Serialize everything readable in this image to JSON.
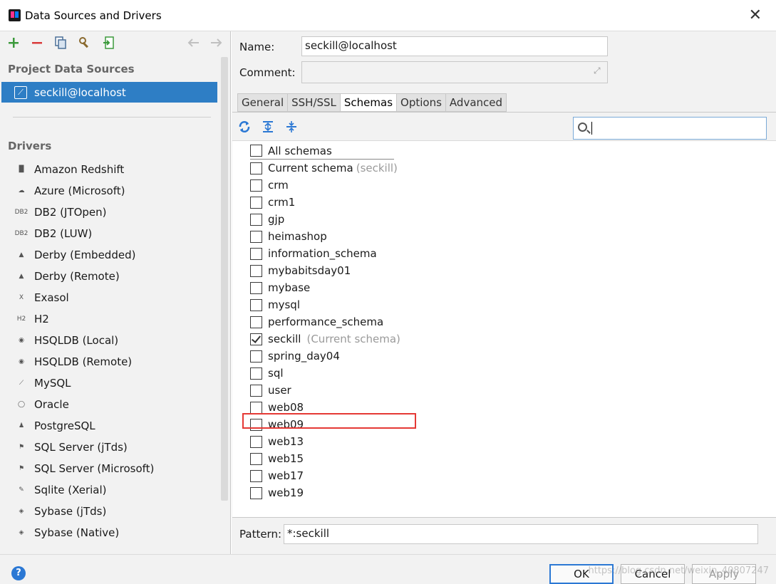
{
  "window": {
    "title": "Data Sources and Drivers"
  },
  "sidebar": {
    "project_header": "Project Data Sources",
    "selected_source": "seckill@localhost",
    "drivers_header": "Drivers",
    "drivers": [
      {
        "label": "Amazon Redshift",
        "icon": "redshift-icon"
      },
      {
        "label": "Azure (Microsoft)",
        "icon": "cloud-icon"
      },
      {
        "label": "DB2 (JTOpen)",
        "icon": "ibm-db2-icon"
      },
      {
        "label": "DB2 (LUW)",
        "icon": "ibm-db2-icon"
      },
      {
        "label": "Derby (Embedded)",
        "icon": "hat-icon"
      },
      {
        "label": "Derby (Remote)",
        "icon": "hat-icon"
      },
      {
        "label": "Exasol",
        "icon": "x-icon"
      },
      {
        "label": "H2",
        "icon": "h2-icon"
      },
      {
        "label": "HSQLDB (Local)",
        "icon": "hsqldb-icon"
      },
      {
        "label": "HSQLDB (Remote)",
        "icon": "hsqldb-icon"
      },
      {
        "label": "MySQL",
        "icon": "mysql-icon"
      },
      {
        "label": "Oracle",
        "icon": "oracle-icon"
      },
      {
        "label": "PostgreSQL",
        "icon": "elephant-icon"
      },
      {
        "label": "SQL Server (jTds)",
        "icon": "sqlserver-icon"
      },
      {
        "label": "SQL Server (Microsoft)",
        "icon": "sqlserver-icon"
      },
      {
        "label": "Sqlite (Xerial)",
        "icon": "feather-icon"
      },
      {
        "label": "Sybase (jTds)",
        "icon": "sybase-icon"
      },
      {
        "label": "Sybase (Native)",
        "icon": "sybase-icon"
      }
    ]
  },
  "form": {
    "name_label": "Name:",
    "name_value": "seckill@localhost",
    "comment_label": "Comment:",
    "comment_value": "",
    "pattern_label": "Pattern:",
    "pattern_value": "*:seckill"
  },
  "tabs": [
    "General",
    "SSH/SSL",
    "Schemas",
    "Options",
    "Advanced"
  ],
  "active_tab": "Schemas",
  "schemas": {
    "all": "All schemas",
    "current": "Current schema",
    "current_hint": "(seckill)",
    "list": [
      {
        "name": "crm",
        "checked": false,
        "hint": ""
      },
      {
        "name": "crm1",
        "checked": false,
        "hint": ""
      },
      {
        "name": "gjp",
        "checked": false,
        "hint": ""
      },
      {
        "name": "heimashop",
        "checked": false,
        "hint": ""
      },
      {
        "name": "information_schema",
        "checked": false,
        "hint": ""
      },
      {
        "name": "mybabitsday01",
        "checked": false,
        "hint": ""
      },
      {
        "name": "mybase",
        "checked": false,
        "hint": ""
      },
      {
        "name": "mysql",
        "checked": false,
        "hint": ""
      },
      {
        "name": "performance_schema",
        "checked": false,
        "hint": ""
      },
      {
        "name": "seckill",
        "checked": true,
        "hint": "(Current schema)"
      },
      {
        "name": "spring_day04",
        "checked": false,
        "hint": ""
      },
      {
        "name": "sql",
        "checked": false,
        "hint": ""
      },
      {
        "name": "user",
        "checked": false,
        "hint": ""
      },
      {
        "name": "web08",
        "checked": false,
        "hint": ""
      },
      {
        "name": "web09",
        "checked": false,
        "hint": ""
      },
      {
        "name": "web13",
        "checked": false,
        "hint": ""
      },
      {
        "name": "web15",
        "checked": false,
        "hint": ""
      },
      {
        "name": "web17",
        "checked": false,
        "hint": ""
      },
      {
        "name": "web19",
        "checked": false,
        "hint": ""
      }
    ]
  },
  "buttons": {
    "ok": "OK",
    "cancel": "Cancel",
    "apply": "Apply",
    "help": "?"
  },
  "watermark": "https://blog.csdn.net/weixin_40807247",
  "colors": {
    "selection": "#2e7ec5",
    "accent": "#2b78d4",
    "highlight_box": "#e53935"
  }
}
